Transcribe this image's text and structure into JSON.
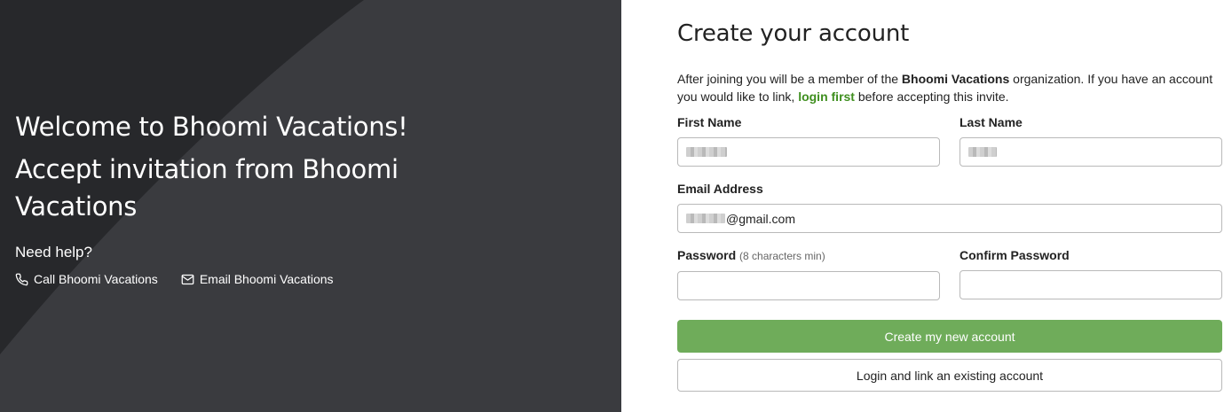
{
  "left": {
    "welcome_title": "Welcome to Bhoomi Vacations!",
    "accept_title": "Accept invitation from Bhoomi Vacations",
    "need_help": "Need help?",
    "call_link": "Call Bhoomi Vacations",
    "email_link": "Email Bhoomi Vacations",
    "call_icon": "phone-icon",
    "email_icon": "envelope-icon"
  },
  "form": {
    "title": "Create your account",
    "intro_part1": "After joining you will be a member of the ",
    "intro_org": "Bhoomi Vacations",
    "intro_part2": " organization. If you have an account you would like to link, ",
    "intro_link": "login first",
    "intro_part3": " before accepting this invite.",
    "first_name_label": "First Name",
    "last_name_label": "Last Name",
    "email_label": "Email Address",
    "email_value": "@gmail.com",
    "password_label": "Password",
    "password_hint": "(8 characters min)",
    "confirm_password_label": "Confirm Password",
    "create_button": "Create my new account",
    "login_button": "Login and link an existing account"
  },
  "colors": {
    "left_bg": "#3a3b3f",
    "primary_button": "#6fac5a",
    "link_green": "#3f8f1f"
  }
}
